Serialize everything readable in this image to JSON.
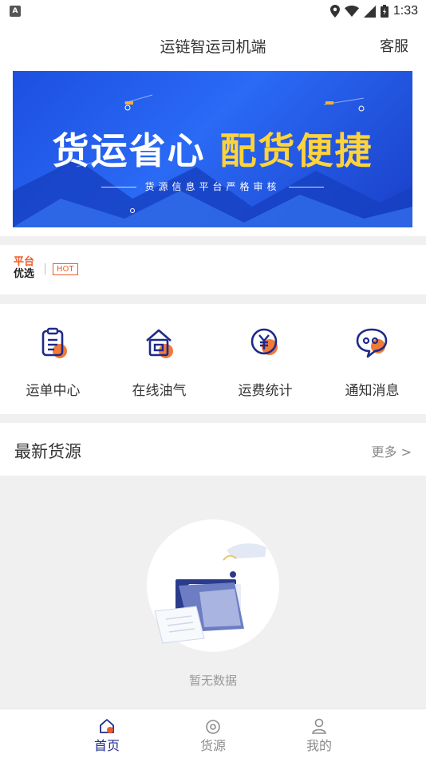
{
  "status_bar": {
    "time": "1:33",
    "notification_badge": "A"
  },
  "header": {
    "title": "运链智运司机端",
    "service_label": "客服"
  },
  "banner": {
    "headline_part1": "货运省心",
    "headline_part2": "配货便捷",
    "subtitle": "货源信息平台严格审核"
  },
  "hot": {
    "logo_line1": "平台",
    "logo_line2": "优选",
    "badge": "HOT"
  },
  "menu": {
    "items": [
      {
        "label": "运单中心",
        "icon": "clipboard-icon"
      },
      {
        "label": "在线油气",
        "icon": "gas-station-icon"
      },
      {
        "label": "运费统计",
        "icon": "yuan-coin-icon"
      },
      {
        "label": "通知消息",
        "icon": "chat-bubble-icon"
      }
    ]
  },
  "latest": {
    "title": "最新货源",
    "more_label": "更多 >"
  },
  "empty_state": {
    "text": "暂无数据"
  },
  "tabbar": {
    "items": [
      {
        "label": "首页",
        "icon": "home-icon",
        "active": true
      },
      {
        "label": "货源",
        "icon": "cargo-icon",
        "active": false
      },
      {
        "label": "我的",
        "icon": "user-icon",
        "active": false
      }
    ]
  },
  "colors": {
    "accent_orange": "#ef5a2a",
    "nav_active": "#1e2a8a",
    "banner_blue": "#1d4fe0",
    "banner_yellow": "#ffd33a"
  }
}
